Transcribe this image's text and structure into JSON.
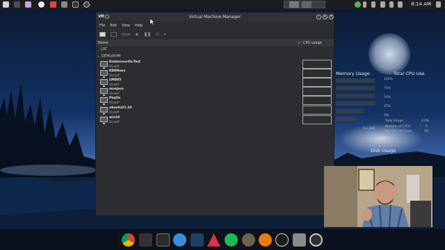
{
  "top_panel": {
    "clock": "8:14 AM",
    "icons": [
      "apps-icon",
      "terminal-icon",
      "files-icon",
      "folder-icon",
      "kde-connect-icon",
      "image-icon",
      "update-icon",
      "steam-icon"
    ],
    "tray_icons": [
      "network-icon",
      "bluetooth-icon",
      "volume-icon",
      "mail-icon",
      "power-icon",
      "battery-icon",
      "calendar-icon"
    ]
  },
  "widgets": {
    "memory_title": "Memory Usage",
    "cpu_title": "Total CPU Use",
    "disk_title": "Disk Usage",
    "cpu_ticks": [
      "75%",
      "50%",
      "25%",
      "0%"
    ],
    "cpu_top": "100%",
    "mem_value": "5.1 GiB",
    "cpu_stats": [
      {
        "label": "Total Usage",
        "value": "2.0%"
      },
      {
        "label": "Number of CPUs",
        "value": "6"
      },
      {
        "label": "Number of Cores",
        "value": "16"
      }
    ]
  },
  "vmm": {
    "title": "Virtual Machine Manager",
    "app_icon_text": "VM",
    "menu": [
      "File",
      "Edit",
      "View",
      "Help"
    ],
    "toolbar": {
      "open_label": "Open"
    },
    "columns": {
      "name": "Name",
      "cpu": "CPU usage"
    },
    "connections": [
      {
        "label": "LXC",
        "expanded": false
      },
      {
        "label": "QEMU/KVM",
        "expanded": true
      }
    ],
    "vms": [
      {
        "name": "EndeavourOs-Test",
        "status": "Shutoff"
      },
      {
        "name": "KDENeon",
        "status": "Shutoff"
      },
      {
        "name": "LMDE5",
        "status": "Shutoff"
      },
      {
        "name": "manjaro",
        "status": "Shutoff"
      },
      {
        "name": "PopOs",
        "status": "Shutoff"
      },
      {
        "name": "ubuntu21.10",
        "status": "Shutoff"
      },
      {
        "name": "win10",
        "status": "Shutoff"
      }
    ]
  },
  "dock": {
    "icons": [
      "chrome-icon",
      "terminal-icon",
      "notes-icon",
      "mail-icon",
      "davinci-icon",
      "video-editor-icon",
      "spotify-icon",
      "gimp-icon",
      "blender-icon",
      "audio-icon",
      "vmm-icon",
      "obs-icon",
      "settings-icon"
    ]
  },
  "colors": {
    "accent": "#3daee9",
    "panel": "#1b1d20",
    "window": "#2b2d30"
  }
}
